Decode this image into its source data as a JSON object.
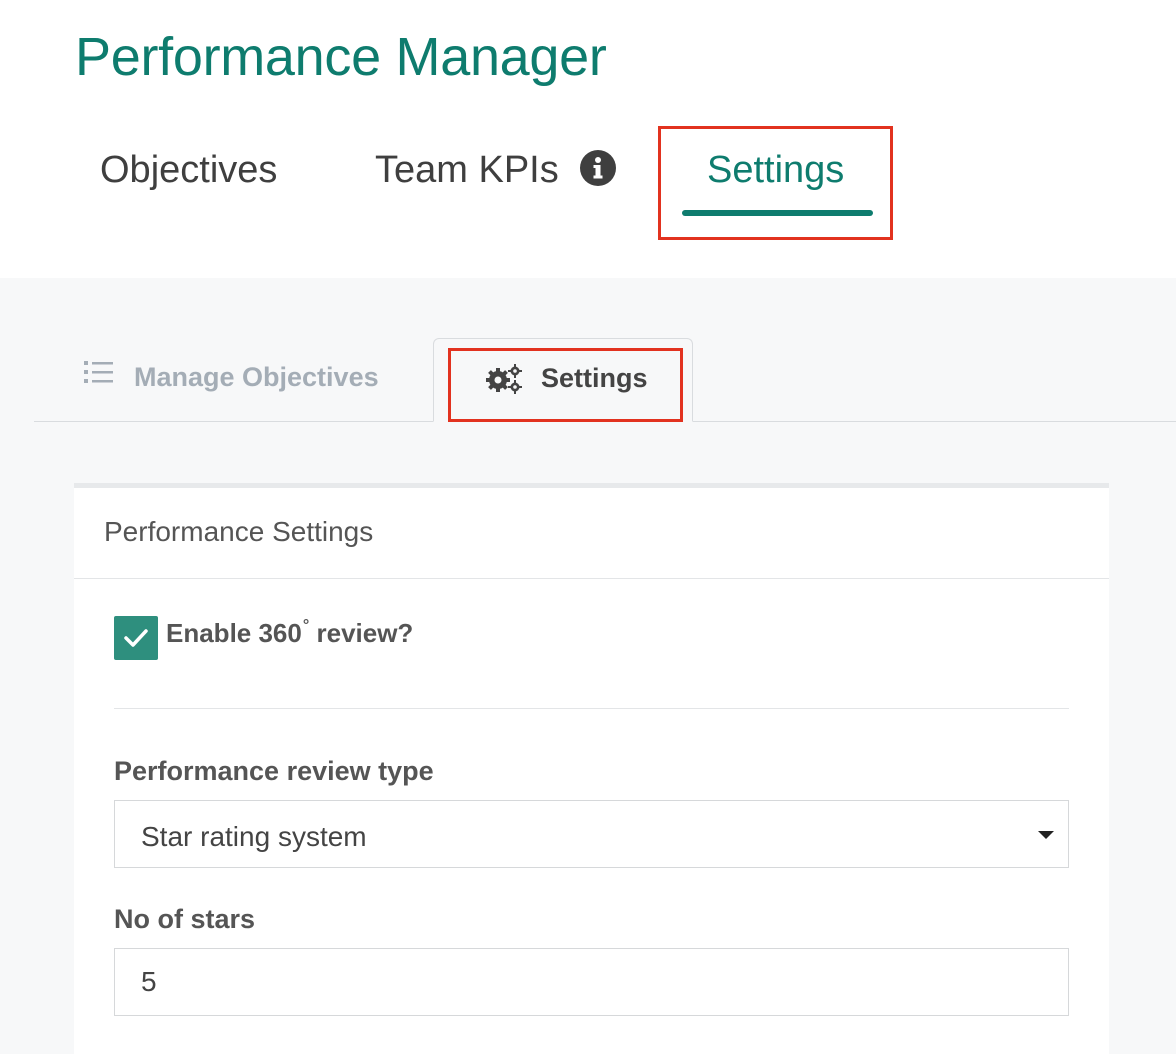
{
  "app": {
    "title": "Performance Manager"
  },
  "top_tabs": [
    {
      "label": "Objectives"
    },
    {
      "label": "Team KPIs",
      "icon": "info-icon"
    },
    {
      "label": "Settings",
      "active": true
    }
  ],
  "sub_tabs": [
    {
      "label": "Manage Objectives",
      "icon": "list-icon"
    },
    {
      "label": "Settings",
      "icon": "gears-icon",
      "active": true
    }
  ],
  "card": {
    "title": "Performance Settings",
    "enable_360": {
      "label_prefix": "Enable 360",
      "degree": "°",
      "label_suffix": " review?",
      "checked": true
    },
    "review_type": {
      "label": "Performance review type",
      "value": "Star rating system"
    },
    "no_of_stars": {
      "label": "No of stars",
      "value": "5"
    }
  },
  "colors": {
    "accent": "#0e7c6e",
    "checkbox": "#2e8f7e",
    "highlight": "#e2321f"
  }
}
